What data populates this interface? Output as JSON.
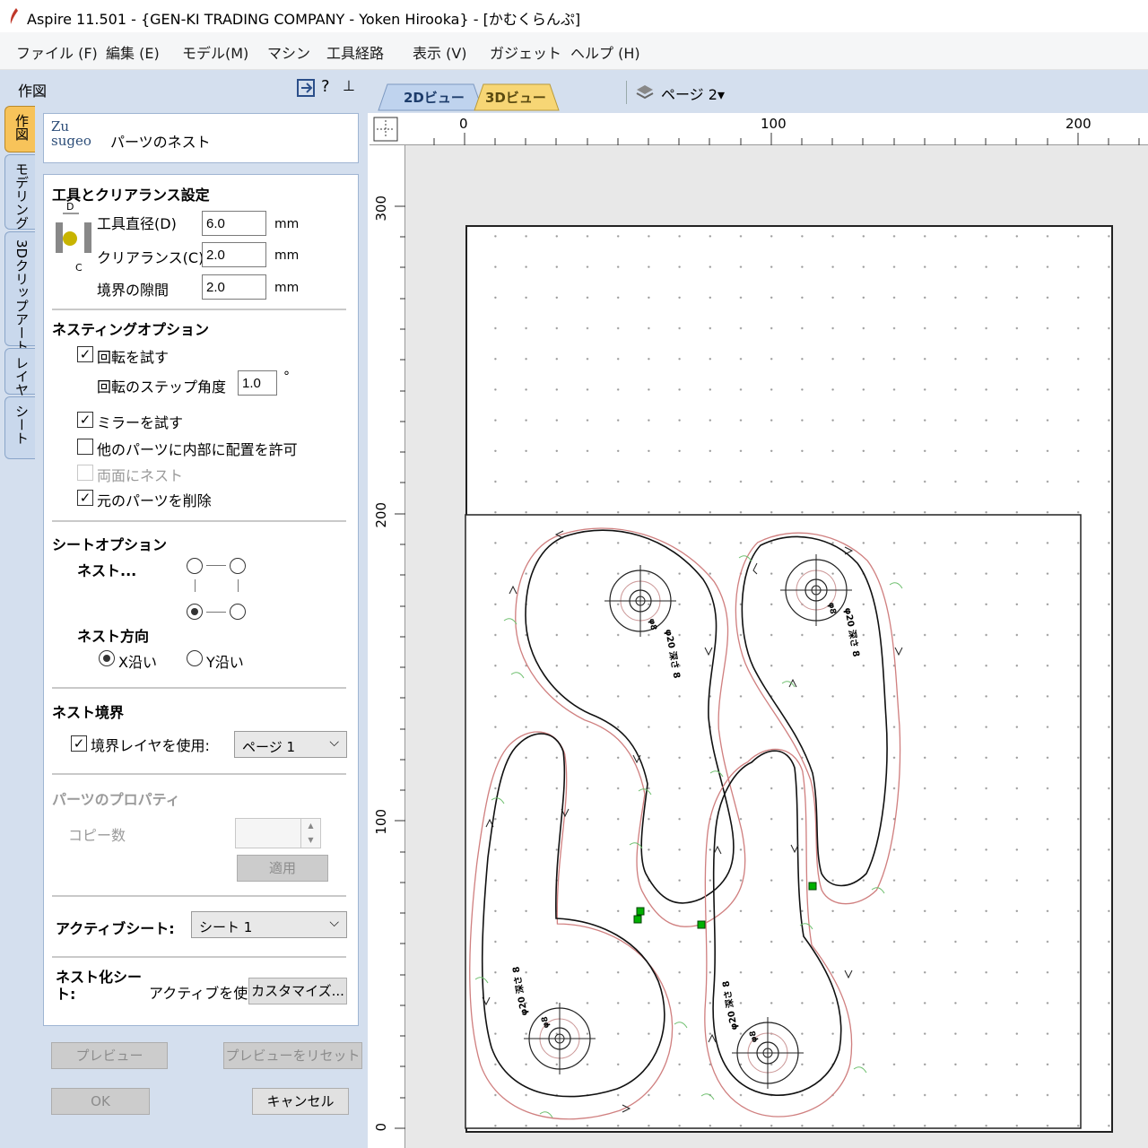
{
  "window": {
    "title": "Aspire 11.501 - {GEN-KI TRADING COMPANY - Yoken Hirooka} - [かむくらんぷ]"
  },
  "menu": [
    "ファイル (F)",
    "編集 (E)",
    "モデル(M)",
    "マシン",
    "工具経路",
    "表示 (V)",
    "ガジェット",
    "ヘルプ (H)"
  ],
  "panel": {
    "header": "作図",
    "header_icons": [
      "pin-to-panel-icon",
      "help-icon",
      "pushpin-icon"
    ],
    "side_tabs": [
      "作図",
      "モデリング",
      "3Dクリップアート",
      "レイヤ",
      "シート"
    ],
    "tool_title": "パーツのネスト",
    "tool_icon_text": "Zu sugeo",
    "tool_clearance": {
      "title": "工具とクリアランス設定",
      "diagram_label_top": "D",
      "diagram_label_bottom": "C",
      "tool_diameter": {
        "label": "工具直径(D)",
        "value": "6.0",
        "unit": "mm"
      },
      "clearance": {
        "label": "クリアランス(C)",
        "value": "2.0",
        "unit": "mm"
      },
      "border_gap": {
        "label": "境界の隙間",
        "value": "2.0",
        "unit": "mm"
      }
    },
    "nesting_options": {
      "title": "ネスティングオプション",
      "try_rotation": {
        "label": "回転を試す",
        "checked": true
      },
      "rotation_step": {
        "label": "回転のステップ角度",
        "value": "1.0",
        "unit": "°"
      },
      "try_mirror": {
        "label": "ミラーを試す",
        "checked": true
      },
      "allow_inside": {
        "label": "他のパーツに内部に配置を許可",
        "checked": false
      },
      "nest_both_sides": {
        "label": "両面にネスト",
        "checked": false,
        "disabled": true
      },
      "delete_original": {
        "label": "元のパーツを削除",
        "checked": true
      }
    },
    "sheet_options": {
      "title": "シートオプション",
      "nest_label": "ネスト...",
      "corner_selected": "bottom-left",
      "direction_label": "ネスト方向",
      "dir_x": "X沿い",
      "dir_y": "Y沿い",
      "direction_selected": "x"
    },
    "nest_border": {
      "title": "ネスト境界",
      "use_border_layer": {
        "label": "境界レイヤを使用:",
        "checked": true
      },
      "layer_value": "ページ 1"
    },
    "part_properties": {
      "title": "パーツのプロパティ",
      "copies_label": "コピー数",
      "copies_value": "",
      "apply_button": "適用"
    },
    "active_sheet": {
      "label": "アクティブシート:",
      "value": "シート 1"
    },
    "nest_sheet": {
      "label": "ネスト化シート:",
      "value": "アクティブを使用",
      "customize_button": "カスタマイズ..."
    },
    "buttons": {
      "preview": "プレビュー",
      "reset_preview": "プレビューをリセット",
      "ok": "OK",
      "cancel": "キャンセル"
    }
  },
  "view_tabs": {
    "tab_2d": "2Dビュー",
    "tab_3d": "3Dビュー",
    "page_label": "ページ 2▾"
  },
  "rulers": {
    "top_labels": [
      "0",
      "100",
      "200"
    ],
    "left_labels": [
      "300",
      "200",
      "100",
      "0"
    ]
  },
  "parts_text": {
    "part1": [
      "φ20 深さ 8",
      "φ8"
    ],
    "part2": [
      "φ20 深さ 8",
      "φ8"
    ],
    "part3": [
      "φ20 深さ 8",
      "φ8"
    ],
    "part4": [
      "φ20 深さ 8",
      "φ8"
    ]
  },
  "colors": {
    "panel_bg": "#d4dfee",
    "active_tab": "#f7c35a",
    "toolpath_red": "#d08080",
    "node_green": "#00b000",
    "marker_green": "#70c070"
  }
}
